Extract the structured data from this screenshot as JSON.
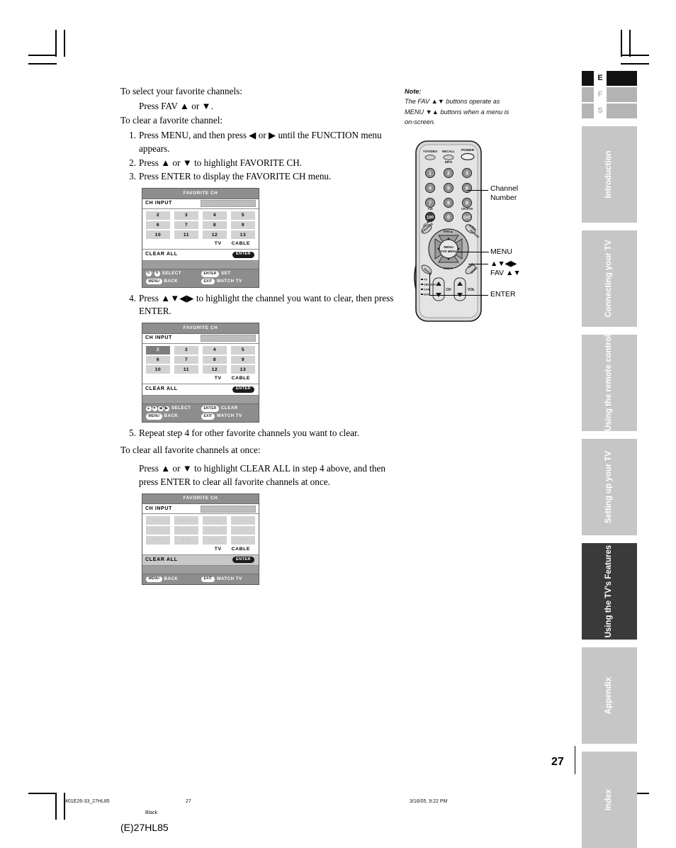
{
  "document": {
    "page_number": "27",
    "model_footer": "(E)27HL85"
  },
  "body": {
    "heading_select": "To select your favorite channels:",
    "select_instruction": "Press FAV ▲ or ▼.",
    "heading_clear": "To clear a favorite channel:",
    "steps": [
      {
        "num": "1.",
        "text": "Press MENU, and then press ◀ or ▶ until the FUNCTION menu appears."
      },
      {
        "num": "2.",
        "text": "Press ▲ or ▼ to highlight FAVORITE CH."
      },
      {
        "num": "3.",
        "text": "Press ENTER to display the FAVORITE CH menu."
      }
    ],
    "step4": {
      "num": "4.",
      "text": "Press ▲▼◀▶ to highlight the channel you want to clear, then press ENTER."
    },
    "step5": {
      "num": "5.",
      "text": "Repeat step 4 for other favorite channels you want to clear."
    },
    "heading_clear_all": "To clear all favorite channels at once:",
    "clear_all_instruction": "Press ▲ or ▼ to highlight CLEAR ALL in step 4 above, and then press ENTER to clear all favorite channels at once."
  },
  "osd1": {
    "title": "FAVORITE CH",
    "ch_input_label": "CH INPUT",
    "ch_input_value": "· · ·",
    "grid": [
      "2",
      "3",
      "4",
      "5",
      "6",
      "7",
      "8",
      "9",
      "10",
      "11",
      "12",
      "13"
    ],
    "selected_index": -1,
    "tv_label": "TV",
    "cable_label": "CABLE",
    "clear_all_label": "CLEAR ALL",
    "clear_all_selected": false,
    "enter_pill": "ENTER",
    "footer": {
      "keys_left": [
        "0",
        "9"
      ],
      "keys_left_sep": "-",
      "action_left": "SELECT",
      "key_right": "ENTER",
      "action_right": "SET",
      "key_left2": "MENU",
      "action_left2": "BACK",
      "key_right2": "EXIT",
      "action_right2": "WATCH TV"
    }
  },
  "osd2": {
    "title": "FAVORITE CH",
    "ch_input_label": "CH INPUT",
    "ch_input_value": "· · ·",
    "grid": [
      "2",
      "3",
      "4",
      "5",
      "6",
      "7",
      "8",
      "9",
      "10",
      "11",
      "12",
      "13"
    ],
    "selected_index": 0,
    "tv_label": "TV",
    "cable_label": "CABLE",
    "clear_all_label": "CLEAR ALL",
    "clear_all_selected": false,
    "enter_pill": "ENTER",
    "footer": {
      "arrow_keys": [
        "▲",
        "▼",
        "◀",
        "▶"
      ],
      "action_left": "SELECT",
      "key_right": "ENTER",
      "action_right": "CLEAR",
      "key_left2": "MENU",
      "action_left2": "BACK",
      "key_right2": "EXIT",
      "action_right2": "WATCH TV"
    }
  },
  "osd3": {
    "title": "FAVORITE CH",
    "ch_input_label": "CH INPUT",
    "ch_input_value": "· · ·",
    "grid": [
      "···",
      "···",
      "···",
      "···",
      "···",
      "···",
      "···",
      "···",
      "···",
      "···",
      "···",
      "···"
    ],
    "selected_index": -1,
    "tv_label": "TV",
    "cable_label": "CABLE",
    "clear_all_label": "CLEAR ALL",
    "clear_all_selected": true,
    "enter_pill": "ENTER",
    "footer": {
      "key_left2": "MENU",
      "action_left2": "BACK",
      "key_right2": "EXIT",
      "action_right2": "WATCH TV"
    }
  },
  "note": {
    "title": "Note:",
    "line1": "The FAV ▲▼ buttons operate as",
    "line2": "MENU ▼▲ buttons when a menu is",
    "line3": "on-screen."
  },
  "remote": {
    "top_buttons": [
      "TV/VIDEO",
      "RECALL",
      "POWER"
    ],
    "recall_sub": "INFO",
    "keypad": [
      "1",
      "2",
      "3",
      "4",
      "5",
      "6",
      "7",
      "8",
      "9",
      "100",
      "0",
      "ENT"
    ],
    "keypad_sub_100": "+10",
    "keypad_sub_ent": "CH RTN",
    "ring_labels": {
      "top_left": "CD MENU",
      "top_left2": "FAVORITE",
      "top_center": "FAV▲",
      "top_right": "GUIDE",
      "top_right2": "PIC SIZE",
      "bottom_center": "FAV▼",
      "bottom_left": "ENTER",
      "bottom_right": "EXIT",
      "bottom_right2": "QUICK"
    },
    "center_button_line1": "MENU",
    "center_button_line2": "DVD MENU",
    "device_keys": [
      "TV",
      "CBL/SAT",
      "VCR",
      "DVD"
    ],
    "ch_label": "CH",
    "vol_label": "VOL",
    "callouts": [
      {
        "line1": "Channel",
        "line2": "Number"
      },
      {
        "line1": "MENU",
        "line2": ""
      },
      {
        "line1": "▲▼◀▶",
        "line2": "FAV ▲▼"
      },
      {
        "line1": "ENTER",
        "line2": ""
      }
    ]
  },
  "sidebar": {
    "languages": [
      {
        "letter": "E",
        "active": true
      },
      {
        "letter": "F",
        "active": false
      },
      {
        "letter": "S",
        "active": false
      }
    ],
    "tabs": [
      {
        "label": "Introduction",
        "active": false
      },
      {
        "label": "Connecting\nyour TV",
        "active": false
      },
      {
        "label": "Using the\nremote control",
        "active": false
      },
      {
        "label": "Setting up\nyour TV",
        "active": false
      },
      {
        "label": "Using the TV’s\nFeatures",
        "active": true
      },
      {
        "label": "Appendix",
        "active": false
      },
      {
        "label": "Index",
        "active": false
      }
    ]
  },
  "footer": {
    "filename": "#01E26-33_27HL85",
    "page": "27",
    "color": "Black",
    "timestamp": "3/16/05, 9:22 PM"
  },
  "colors": {
    "accent_dark": "#3a3a3a",
    "tab_gray": "#c6c6c6",
    "osd_gray": "#9d9d9d"
  }
}
